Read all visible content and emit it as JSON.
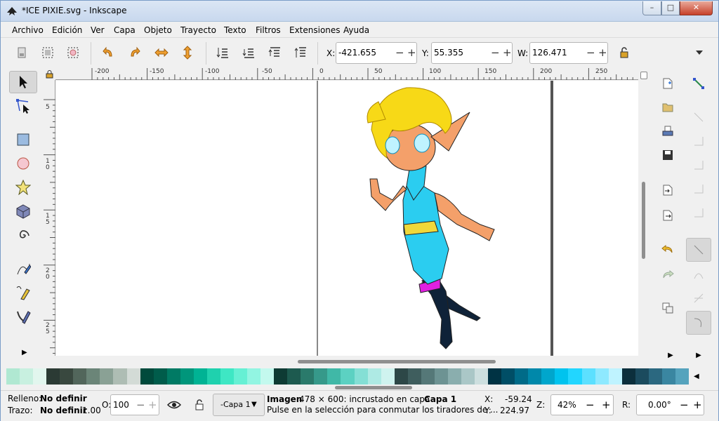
{
  "window": {
    "title": "*ICE PIXIE.svg - Inkscape",
    "min": "–",
    "max": "□",
    "close": "✕"
  },
  "menu": [
    "Archivo",
    "Edición",
    "Ver",
    "Capa",
    "Objeto",
    "Trayecto",
    "Texto",
    "Filtros",
    "Extensiones",
    "Ayuda"
  ],
  "coords": {
    "x_label": "X:",
    "x": "-421.655",
    "y_label": "Y:",
    "y": "55.355",
    "w_label": "W:",
    "w": "126.471",
    "minus": "−",
    "plus": "+"
  },
  "ruler_top": [
    "-200",
    "-150",
    "-100",
    "-50",
    "0",
    "50",
    "100",
    "150",
    "200",
    "250"
  ],
  "ruler_left": [
    "5",
    "1 0",
    "1 5",
    "2 0",
    "2 5"
  ],
  "status": {
    "fill_label": "Relleno:",
    "fill_value": "No definir",
    "stroke_label": "Trazo:",
    "stroke_value": "No definir",
    "stroke_width": "1.00",
    "opacity_label": "O:",
    "opacity": "100",
    "layer": "-Capa 1",
    "msg_bold": "Imagen",
    "msg_line1": " 478 × 600: incrustado en capa ",
    "msg_layer": "Capa 1",
    "msg_end": ".",
    "msg_line2": "Pulse en la selección para conmutar los tiradores de ...",
    "cx_label": "X:",
    "cx": "-59.24",
    "cy_label": "Y:",
    "cy": "224.97",
    "zoom_label": "Z:",
    "zoom": "42%",
    "rot_label": "R:",
    "rot": "0.00°"
  },
  "palette": [
    "#b0e8d2",
    "#c8f0e0",
    "#e2f6ee",
    "#2b3a34",
    "#39483f",
    "#52665b",
    "#6b8578",
    "#8aa195",
    "#aebdb4",
    "#d3dbd6",
    "#004a3c",
    "#005c4b",
    "#007a64",
    "#00967b",
    "#00b394",
    "#1fd1ae",
    "#3ee7c4",
    "#66f0d4",
    "#92f5e2",
    "#c3f9ee",
    "#0e3b34",
    "#1d5a4f",
    "#2a7a6b",
    "#36998a",
    "#40b8a7",
    "#5cd1c2",
    "#84dfd5",
    "#aeeae4",
    "#cff3ef",
    "#2d4747",
    "#3f5e5e",
    "#557878",
    "#6d9393",
    "#8aaeae",
    "#aac7c7",
    "#cddfdf",
    "#003344",
    "#004e66",
    "#006b88",
    "#0088aa",
    "#00a6cc",
    "#00c3ee",
    "#22d6ff",
    "#5ce0ff",
    "#8ee9ff",
    "#bff3ff",
    "#0c2f3c",
    "#1b4b5e",
    "#2b6880",
    "#3a86a1",
    "#55a3bd"
  ],
  "colors": {
    "hair": "#f7d917",
    "skin": "#f4a06a",
    "suit": "#2bcdf0",
    "boots": "#0f2238",
    "accent": "#e020e0",
    "trim": "#f0d83a",
    "eyes": "#bff3ff"
  },
  "icons": [
    "inkscape-icon",
    "open-icon",
    "select-all-icon",
    "select-all-layers-icon",
    "rotate-ccw-icon",
    "rotate-cw-icon",
    "flip-horizontal-icon",
    "flip-vertical-icon",
    "lower-bottom-icon",
    "lower-icon",
    "raise-icon",
    "raise-top-icon",
    "lock-icon",
    "dropdown-icon",
    "selector-tool-icon",
    "node-tool-icon",
    "rectangle-tool-icon",
    "ellipse-tool-icon",
    "star-tool-icon",
    "box-3d-tool-icon",
    "spiral-tool-icon",
    "pencil-tool-icon",
    "pen-tool-icon",
    "calligraphy-tool-icon",
    "new-document-icon",
    "open-document-icon",
    "print-icon",
    "save-icon",
    "import-icon",
    "export-icon",
    "undo-icon",
    "redo-icon",
    "duplicate-icon",
    "snap-icon",
    "eye-icon"
  ]
}
